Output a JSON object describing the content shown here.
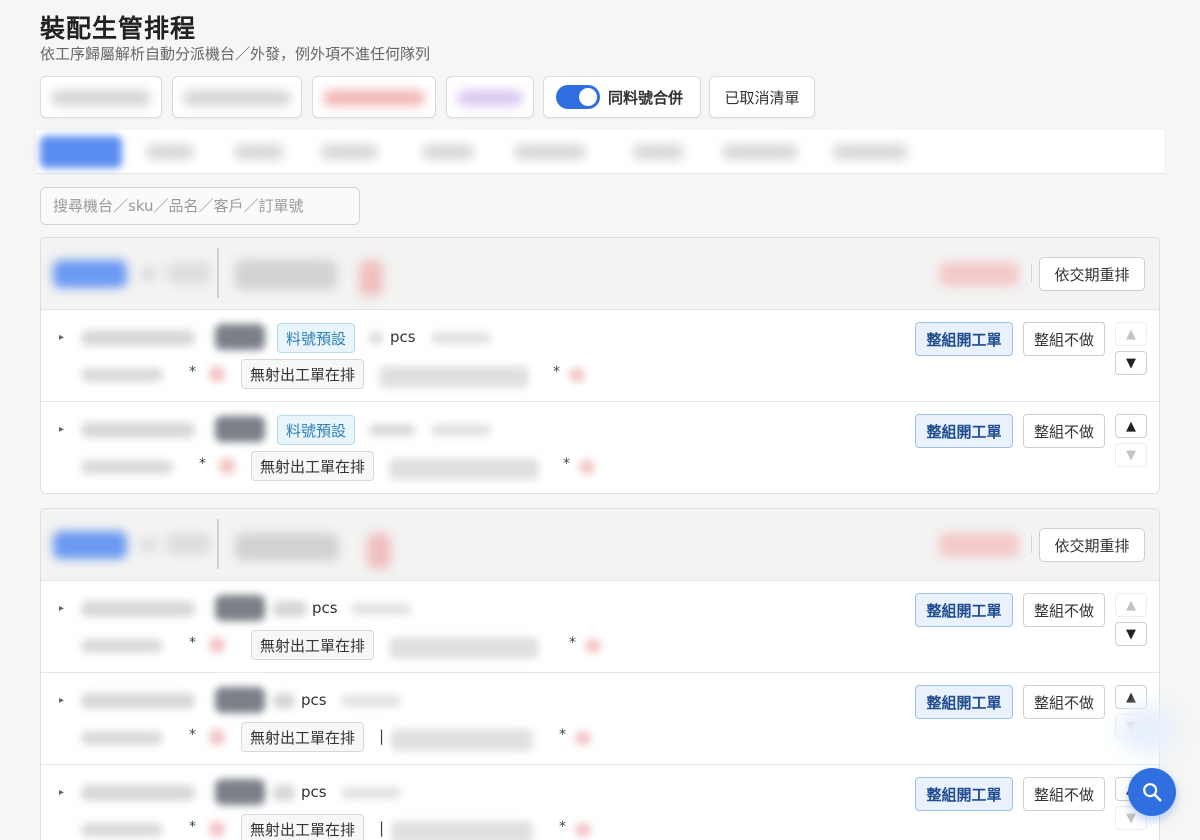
{
  "page": {
    "title": "裝配生管排程",
    "subtitle": "依工序歸屬解析自動分派機台／外發，例外項不進任何隊列"
  },
  "toolbar": {
    "merge_toggle_label": "同料號合併",
    "merge_toggle_on": true,
    "cancelled_list_label": "已取消清單"
  },
  "search": {
    "placeholder": "搜尋機台／sku／品名／客戶／訂單號"
  },
  "groups": [
    {
      "reorder_label": "依交期重排",
      "rows": [
        {
          "tag": "料號預設",
          "pcs": "pcs",
          "status_tag": "無射出工單在排",
          "star1": "*",
          "star2": "*",
          "up_enabled": false,
          "down_enabled": true
        },
        {
          "tag": "料號預設",
          "pcs": "",
          "status_tag": "無射出工單在排",
          "star1": "*",
          "star2": "*",
          "up_enabled": true,
          "down_enabled": false
        }
      ]
    },
    {
      "reorder_label": "依交期重排",
      "rows": [
        {
          "pcs": "pcs",
          "status_tag": "無射出工單在排",
          "star1": "*",
          "star2": "*",
          "up_enabled": false,
          "down_enabled": true
        },
        {
          "pcs": "pcs",
          "status_tag": "無射出工單在排",
          "pipe": "|",
          "star1": "*",
          "star2": "*",
          "up_enabled": true,
          "down_enabled": false
        },
        {
          "pcs": "pcs",
          "status_tag": "無射出工單在排",
          "pipe": "|",
          "star1": "*",
          "star2": "*"
        }
      ]
    }
  ],
  "row_actions": {
    "open_group_label": "整組開工單",
    "skip_group_label": "整組不做",
    "expand_glyph": "▸",
    "up_glyph": "▲",
    "down_glyph": "▼"
  },
  "icons": {
    "fab": "search-icon",
    "toggle": "toggle-switch"
  },
  "colors": {
    "accent": "#2f6fe0",
    "tag_blue_text": "#2c7fb8",
    "open_button_text": "#1f4d8f"
  }
}
